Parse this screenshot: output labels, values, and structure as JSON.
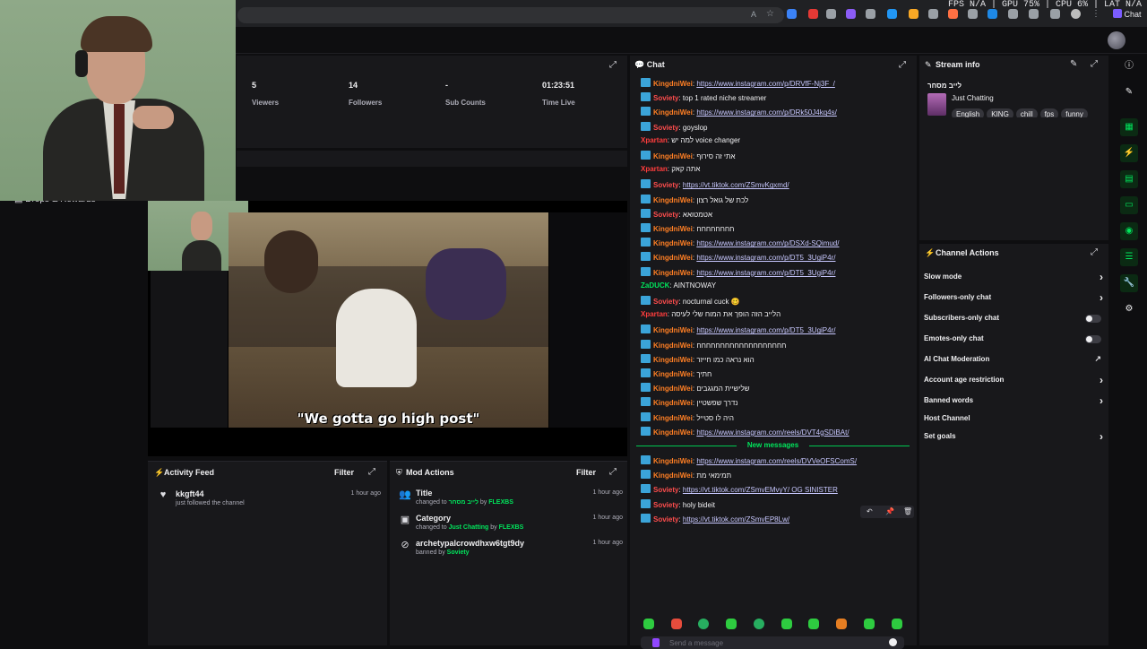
{
  "system_stats": "FPS N/A | GPU 75% | CPU 6% | LAT N/A",
  "browser": {
    "profile_label": "Chat"
  },
  "sidebar": {
    "drops_label": "Drops & Rewards"
  },
  "stats": [
    {
      "value": "5",
      "label": "Viewers"
    },
    {
      "value": "14",
      "label": "Followers"
    },
    {
      "value": "-",
      "label": "Sub Counts"
    },
    {
      "value": "01:23:51",
      "label": "Time Live"
    }
  ],
  "preview": {
    "caption": "\"We gotta go high post\""
  },
  "activity_feed": {
    "title": "Activity Feed",
    "filter": "Filter",
    "items": [
      {
        "name": "kkgft44",
        "sub": "just followed the channel",
        "time": "1 hour ago"
      }
    ]
  },
  "mod_actions": {
    "title": "Mod Actions",
    "filter": "Filter",
    "items": [
      {
        "name": "Title",
        "sub_prefix": "changed to ",
        "sub_value": "לייב מסחר",
        "sub_mid": " by ",
        "sub_by": "FLEXBS",
        "time": "1 hour ago"
      },
      {
        "name": "Category",
        "sub_prefix": "changed to ",
        "sub_value": "Just Chatting",
        "sub_mid": " by ",
        "sub_by": "FLEXBS",
        "time": "1 hour ago"
      },
      {
        "name": "archetypalcrowdhxw6tgt9dy",
        "sub_prefix": "banned by ",
        "sub_value": "",
        "sub_mid": "",
        "sub_by": "Soviety",
        "time": "1 hour ago"
      }
    ]
  },
  "chat": {
    "title": "Chat",
    "new_messages_label": "New messages",
    "input_placeholder": "Send a message",
    "messages": [
      {
        "badge": true,
        "user": "KingdniWei",
        "color": "#ff7f24",
        "text": "https://www.instagram.com/p/DRVfF-Nj3F_/",
        "link": true
      },
      {
        "badge": true,
        "user": "Soviety",
        "color": "#ff4d4d",
        "text": "top 1 rated niche streamer",
        "link": false
      },
      {
        "badge": true,
        "user": "KingdniWei",
        "color": "#ff7f24",
        "text": "https://www.instagram.com/p/DRk50J4kq4s/",
        "link": true
      },
      {
        "badge": true,
        "user": "Soviety",
        "color": "#ff4d4d",
        "text": "goyslop",
        "link": false
      },
      {
        "badge": false,
        "user": "Xpartan",
        "color": "#ff3d3d",
        "text": "למה יש voice changer",
        "link": false
      },
      {
        "badge": true,
        "user": "KingdniWei",
        "color": "#ff7f24",
        "text": "אתי זה סירוף",
        "link": false
      },
      {
        "badge": false,
        "user": "Xpartan",
        "color": "#ff3d3d",
        "text": "אתה קאק",
        "link": false
      },
      {
        "badge": true,
        "user": "Soviety",
        "color": "#ff4d4d",
        "text": "https://vt.tiktok.com/ZSmvKgxmd/",
        "link": true
      },
      {
        "badge": true,
        "user": "KingdniWei",
        "color": "#ff7f24",
        "text": "לכת של גואל רצון",
        "link": false
      },
      {
        "badge": true,
        "user": "Soviety",
        "color": "#ff4d4d",
        "text": "אטמטואא",
        "link": false
      },
      {
        "badge": true,
        "user": "KingdniWei",
        "color": "#ff7f24",
        "text": "חחחחחחחח",
        "link": false
      },
      {
        "badge": true,
        "user": "KingdniWei",
        "color": "#ff7f24",
        "text": "https://www.instagram.com/p/DSXd-SQimud/",
        "link": true
      },
      {
        "badge": true,
        "user": "KingdniWei",
        "color": "#ff7f24",
        "text": "https://www.instagram.com/p/DT5_3UgiP4r/",
        "link": true
      },
      {
        "badge": true,
        "user": "KingdniWei",
        "color": "#ff7f24",
        "text": "https://www.instagram.com/p/DT5_3UgiP4r/",
        "link": true
      },
      {
        "badge": false,
        "user": "ZaDUCK",
        "color": "#00e65c",
        "text": "AINTNOWAY",
        "link": false
      },
      {
        "badge": true,
        "user": "Soviety",
        "color": "#ff4d4d",
        "text": "nocturnal cuck 🥴",
        "link": false
      },
      {
        "badge": false,
        "user": "Xpartan",
        "color": "#ff3d3d",
        "text": "הלייב הזה הופך את המוח שלי לעיסה",
        "link": false
      },
      {
        "badge": true,
        "user": "KingdniWei",
        "color": "#ff7f24",
        "text": "https://www.instagram.com/p/DT5_3UgiP4r/",
        "link": true
      },
      {
        "badge": true,
        "user": "KingdniWei",
        "color": "#ff7f24",
        "text": "חחחחחחחחחחחחחחחחחחח",
        "link": false
      },
      {
        "badge": true,
        "user": "KingdniWei",
        "color": "#ff7f24",
        "text": "הוא נראה כמו חייזר",
        "link": false
      },
      {
        "badge": true,
        "user": "KingdniWei",
        "color": "#ff7f24",
        "text": "חתיך",
        "link": false
      },
      {
        "badge": true,
        "user": "KingdniWei",
        "color": "#ff7f24",
        "text": "שלישיית המגגבים",
        "link": false
      },
      {
        "badge": true,
        "user": "KingdniWei",
        "color": "#ff7f24",
        "text": "נדרך שפשטיין",
        "link": false
      },
      {
        "badge": true,
        "user": "KingdniWei",
        "color": "#ff7f24",
        "text": "היה לו סטייל",
        "link": false
      },
      {
        "badge": true,
        "user": "KingdniWei",
        "color": "#ff7f24",
        "text": "https://www.instagram.com/reels/DVT4gSDiBAt/",
        "link": true
      }
    ],
    "new_messages": [
      {
        "badge": true,
        "user": "KingdniWei",
        "color": "#ff7f24",
        "text": "https://www.instagram.com/reels/DVVeOFSComS/",
        "link": true
      },
      {
        "badge": true,
        "user": "KingdniWei",
        "color": "#ff7f24",
        "text": "תמימאי מת",
        "link": false
      },
      {
        "badge": true,
        "user": "Soviety",
        "color": "#ff4d4d",
        "text": "https://vt.tiktok.com/ZSmvEMvyY/ OG SINISTER",
        "link": true
      },
      {
        "badge": true,
        "user": "Soviety",
        "color": "#ff4d4d",
        "text": "holy bideit",
        "link": false
      },
      {
        "badge": true,
        "user": "Soviety",
        "color": "#ff4d4d",
        "text": "https://vt.tiktok.com/ZSmvEP8Lw/",
        "link": true
      }
    ]
  },
  "stream_info": {
    "title": "Stream info",
    "stream_name": "לייב מסחר",
    "category": "Just Chatting",
    "tags": [
      "English",
      "KING",
      "chill",
      "fps",
      "funny"
    ]
  },
  "channel_actions": {
    "title": "Channel Actions",
    "items": [
      {
        "label": "Slow mode",
        "control": "chevron"
      },
      {
        "label": "Followers-only chat",
        "control": "chevron"
      },
      {
        "label": "Subscribers-only chat",
        "control": "toggle"
      },
      {
        "label": "Emotes-only chat",
        "control": "toggle"
      },
      {
        "label": "AI Chat Moderation",
        "control": "external"
      },
      {
        "label": "Account age restriction",
        "control": "chevron"
      },
      {
        "label": "Banned words",
        "control": "chevron"
      },
      {
        "label": "Host Channel",
        "control": "none"
      },
      {
        "label": "Set goals",
        "control": "chevron"
      }
    ]
  },
  "colors": {
    "accent_green": "#00e65c",
    "panel_bg": "#18181b",
    "page_bg": "#0e0e10",
    "badge_blue": "#3ba4d9"
  }
}
